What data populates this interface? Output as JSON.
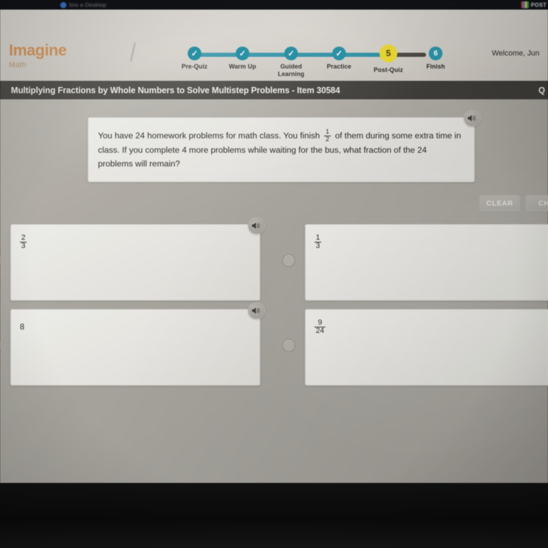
{
  "os_bar": {
    "tab_label": "Ims e-Desktop",
    "right_icon": "multicolor-grid-icon",
    "right_label": "POST"
  },
  "header": {
    "logo_main": "Imagine",
    "logo_sub": "Math",
    "welcome": "Welcome, Jun",
    "progress": {
      "steps": [
        {
          "label": "Pre-Quiz",
          "marker": "✓",
          "state": "complete"
        },
        {
          "label": "Warm Up",
          "marker": "✓",
          "state": "complete"
        },
        {
          "label": "Guided\nLearning",
          "marker": "✓",
          "state": "complete"
        },
        {
          "label": "Practice",
          "marker": "✓",
          "state": "complete"
        },
        {
          "label": "Post-Quiz",
          "marker": "5",
          "state": "current"
        },
        {
          "label": "Finish",
          "marker": "6",
          "state": "upcoming"
        }
      ],
      "complete_color": "#1d93ab",
      "current_color": "#edd81c",
      "upcoming_line_color": "#4a4641"
    }
  },
  "title_bar": {
    "title": "Multiplying Fractions by Whole Numbers to Solve Multistep Problems - Item 30584",
    "right_text": "Q"
  },
  "question": {
    "part1": "You have 24 homework problems for math class. You finish ",
    "fraction": {
      "numerator": "1",
      "denominator": "2"
    },
    "part2": " of them during some extra time in class. If you complete 4 more problems while waiting for the bus, what fraction of the 24 problems will remain?",
    "speaker_icon": "speaker-icon"
  },
  "toolbar": {
    "clear_label": "CLEAR",
    "check_label": "CH"
  },
  "answers": [
    {
      "id": "a",
      "type": "fraction",
      "numerator": "2",
      "denominator": "3",
      "selected": false,
      "has_speaker": true
    },
    {
      "id": "b",
      "type": "fraction",
      "numerator": "1",
      "denominator": "3",
      "selected": false,
      "has_speaker": false
    },
    {
      "id": "c",
      "type": "whole",
      "value": "8",
      "selected": false,
      "has_speaker": true
    },
    {
      "id": "d",
      "type": "fraction",
      "numerator": "9",
      "denominator": "24",
      "selected": false,
      "has_speaker": false
    }
  ]
}
